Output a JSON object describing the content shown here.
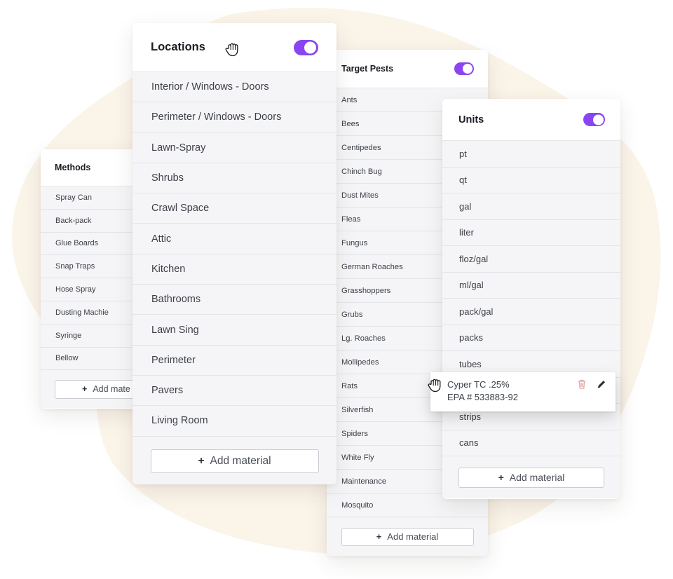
{
  "colors": {
    "accent": "#8b45f0",
    "blob_bg": "#fbf4e9",
    "delete_icon": "#e8a5a5"
  },
  "methods": {
    "title": "Methods",
    "items": [
      "Spray Can",
      "Back-pack",
      "Glue Boards",
      "Snap Traps",
      "Hose Spray",
      "Dusting Machie",
      "Syringe",
      "Bellow"
    ],
    "add_label": "Add mate"
  },
  "locations": {
    "title": "Locations",
    "toggle_on": true,
    "items": [
      "Interior / Windows - Doors",
      "Perimeter / Windows - Doors",
      "Lawn-Spray",
      "Shrubs",
      "Crawl Space",
      "Attic",
      "Kitchen",
      "Bathrooms",
      "Lawn Sing",
      "Perimeter",
      "Pavers",
      "Living Room"
    ],
    "add_label": "Add material"
  },
  "pests": {
    "title": "Target Pests",
    "toggle_on": true,
    "items": [
      "Ants",
      "Bees",
      "Centipedes",
      "Chinch Bug",
      "Dust Mites",
      "Fleas",
      "Fungus",
      "German Roaches",
      "Grasshoppers",
      "Grubs",
      "Lg. Roaches",
      "Mollipedes",
      "Rats",
      "Silverfish",
      "Spiders",
      "White Fly",
      "Maintenance",
      "Mosquito"
    ],
    "add_label": "Add material"
  },
  "units": {
    "title": "Units",
    "toggle_on": true,
    "items": [
      "pt",
      "qt",
      "gal",
      "liter",
      "floz/gal",
      "ml/gal",
      "pack/gal",
      "packs",
      "tubes",
      "",
      "strips",
      "cans"
    ],
    "add_label": "Add material"
  },
  "drag_item": {
    "name": "Cyper TC .25%",
    "epa": "EPA # 533883-92"
  },
  "icons": {
    "grab": "hand-grab-icon",
    "plus": "plus-icon",
    "delete": "trash-icon",
    "edit": "pencil-icon"
  }
}
